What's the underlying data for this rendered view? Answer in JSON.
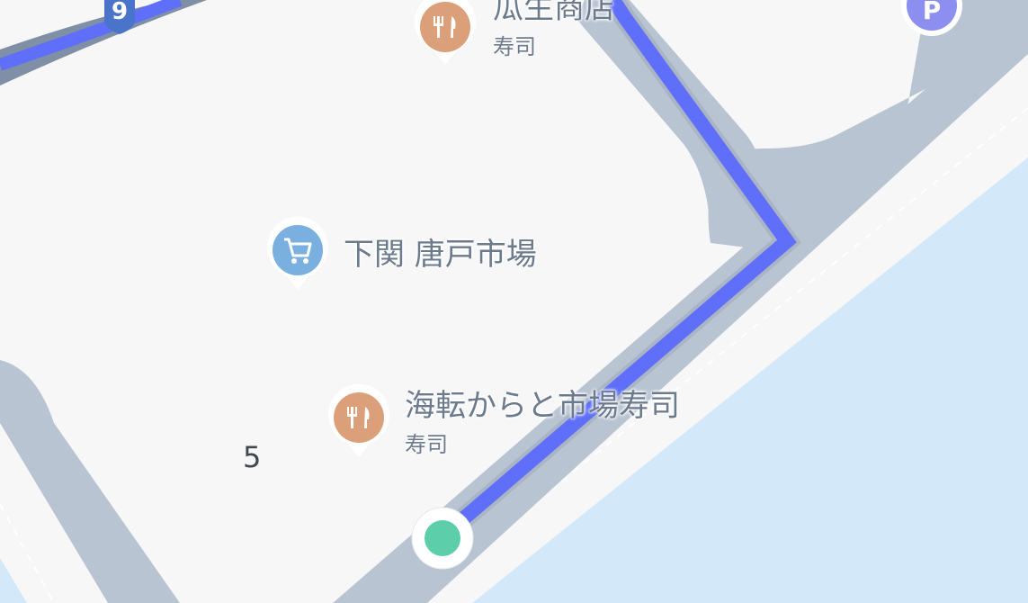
{
  "map": {
    "colors": {
      "land": "#f7f7f7",
      "road": "#b9c4d3",
      "road_edge": "#a9b5c5",
      "water": "#d3e9fa",
      "route": "#5f6ffa",
      "food_marker": "#dba07a",
      "shop_marker": "#7ab0e0",
      "parking_marker": "#8d8ff0",
      "highway_shield": "#4a74c9",
      "current_location": "#5ccfaa",
      "poi_text": "#6b7a8c"
    },
    "route_shield": {
      "number": "9",
      "icon": "highway-shield-icon"
    },
    "parking": {
      "letter": "P",
      "icon": "parking-icon"
    },
    "block_number": "5",
    "pois": [
      {
        "id": "urio",
        "name": "瓜生商店",
        "category": "寿司",
        "icon": "fork-knife-icon",
        "type": "restaurant"
      },
      {
        "id": "karato",
        "name": "下関 唐戸市場",
        "category": "",
        "icon": "shopping-cart-icon",
        "type": "shop"
      },
      {
        "id": "kaiten",
        "name": "海転からと市場寿司",
        "category": "寿司",
        "icon": "fork-knife-icon",
        "type": "restaurant"
      }
    ],
    "current_location": {
      "icon": "current-location-dot"
    }
  }
}
